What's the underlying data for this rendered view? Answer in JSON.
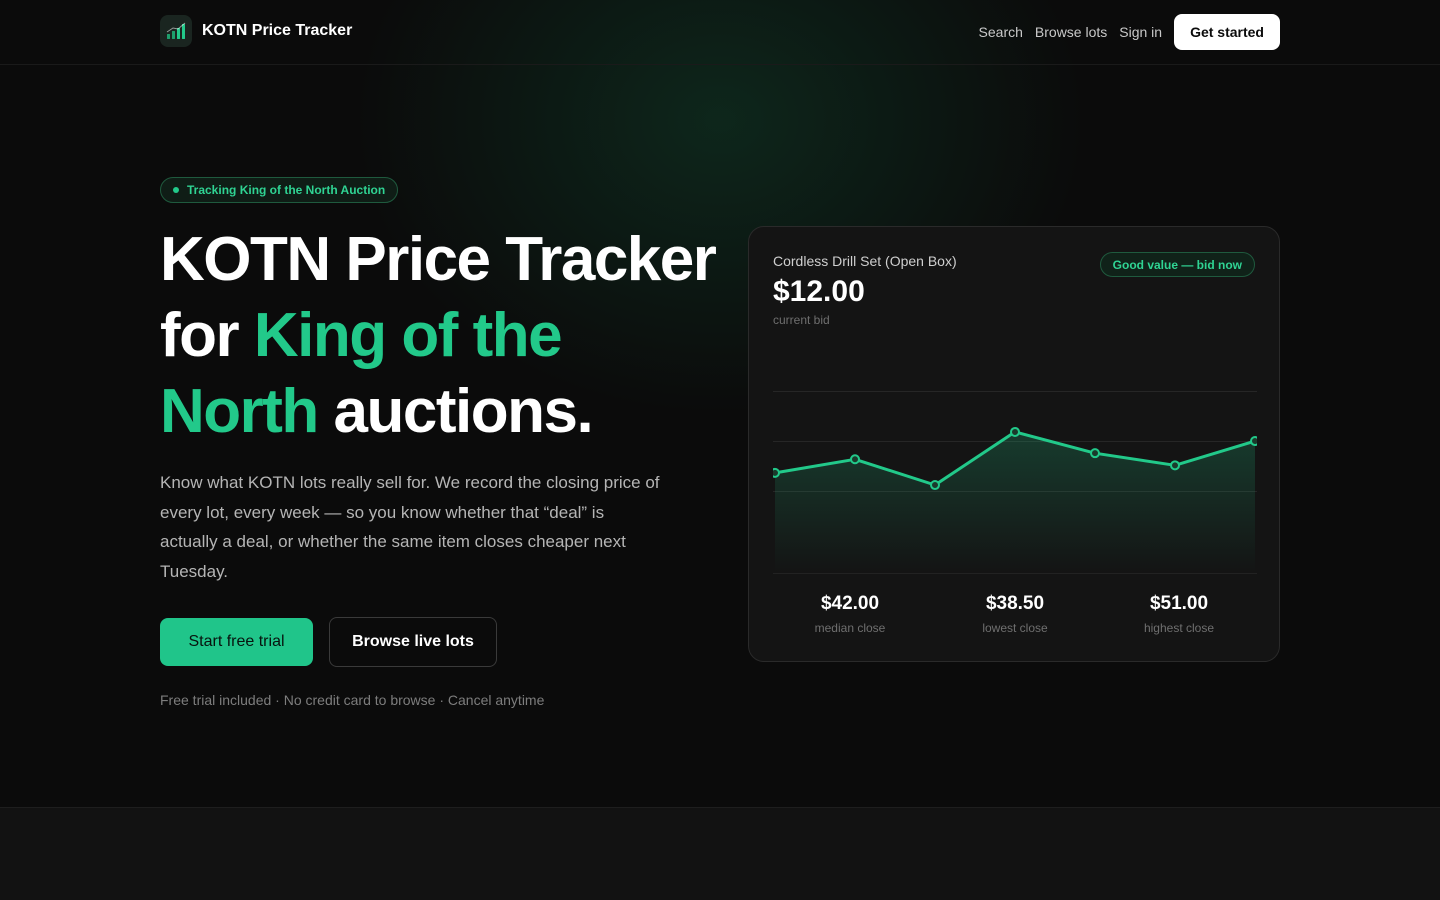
{
  "brand": {
    "name": "KOTN Price Tracker",
    "logo_icon": "bar-chart-icon"
  },
  "nav": {
    "links": [
      "Search",
      "Browse lots",
      "Sign in"
    ],
    "cta_label": "Get started"
  },
  "hero": {
    "pill_text": "Tracking King of the North Auction",
    "headline_part1": "KOTN Price Tracker for ",
    "headline_accent": "King of the North",
    "headline_part2": " auctions.",
    "subtext": "Know what KOTN lots really sell for. We record the closing price of every lot, every week — so you know whether that “deal” is actually a deal, or whether the same item closes cheaper next Tuesday.",
    "primary_button": "Start free trial",
    "secondary_button": "Browse live lots",
    "fineprint": "Free trial included · No credit card to browse · Cancel anytime"
  },
  "card": {
    "item_name": "Cordless Drill Set (Open Box)",
    "current_price": "$12.00",
    "current_price_label": "current bid",
    "badge": "Good value — bid now",
    "stats": [
      {
        "value": "$42.00",
        "label": "median close"
      },
      {
        "value": "$38.50",
        "label": "lowest close"
      },
      {
        "value": "$51.00",
        "label": "highest close"
      }
    ]
  },
  "colors": {
    "accent": "#22c98a",
    "background": "#0b0b0b",
    "card": "#141414"
  },
  "chart_data": {
    "type": "line",
    "x": [
      1,
      2,
      3,
      4,
      5,
      6,
      7
    ],
    "values": [
      43.0,
      47.5,
      39.0,
      56.5,
      49.5,
      45.5,
      53.5
    ],
    "ylim": [
      10,
      70
    ],
    "grid": true,
    "title": "",
    "xlabel": "",
    "ylabel": ""
  }
}
